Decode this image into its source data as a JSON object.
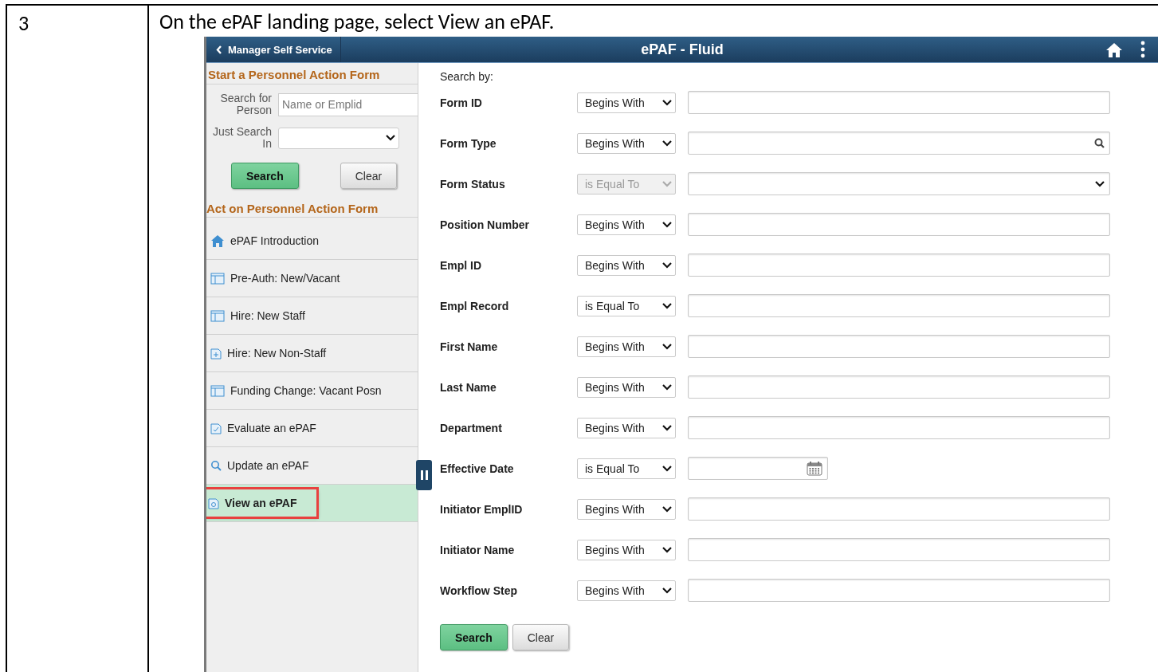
{
  "step": {
    "number": "3",
    "instruction": "On the ePAF landing page, select View an ePAF."
  },
  "app": {
    "header": {
      "back_label": "Manager Self Service",
      "title": "ePAF - Fluid"
    },
    "sidebar": {
      "start_section": {
        "title": "Start a Personnel Action Form",
        "person_label": "Search for Person",
        "person_placeholder": "Name or Emplid",
        "search_in_label": "Just Search In",
        "search_button": "Search",
        "clear_button": "Clear"
      },
      "act_section": {
        "title": "Act on Personnel Action Form"
      },
      "items": [
        {
          "label": "ePAF Introduction",
          "kind": "home",
          "selected": false,
          "annotated": false
        },
        {
          "label": "Pre-Auth: New/Vacant",
          "kind": "form",
          "selected": false,
          "annotated": false
        },
        {
          "label": "Hire: New Staff",
          "kind": "form",
          "selected": false,
          "annotated": false
        },
        {
          "label": "Hire: New Non-Staff",
          "kind": "add",
          "selected": false,
          "annotated": false
        },
        {
          "label": "Funding Change: Vacant Posn",
          "kind": "form",
          "selected": false,
          "annotated": false
        },
        {
          "label": "Evaluate an ePAF",
          "kind": "check",
          "selected": false,
          "annotated": false
        },
        {
          "label": "Update an ePAF",
          "kind": "search",
          "selected": false,
          "annotated": false
        },
        {
          "label": "View an ePAF",
          "kind": "view",
          "selected": true,
          "annotated": true
        }
      ]
    },
    "main": {
      "search_by": "Search by:",
      "fields": [
        {
          "label": "Form ID",
          "operator": "Begins With",
          "disabled": false,
          "kind": "text"
        },
        {
          "label": "Form Type",
          "operator": "Begins With",
          "disabled": false,
          "kind": "lookup"
        },
        {
          "label": "Form Status",
          "operator": "is Equal To",
          "disabled": true,
          "kind": "dropdown"
        },
        {
          "label": "Position Number",
          "operator": "Begins With",
          "disabled": false,
          "kind": "text"
        },
        {
          "label": "Empl ID",
          "operator": "Begins With",
          "disabled": false,
          "kind": "text"
        },
        {
          "label": "Empl Record",
          "operator": "is Equal To",
          "disabled": false,
          "kind": "text"
        },
        {
          "label": "First Name",
          "operator": "Begins With",
          "disabled": false,
          "kind": "text"
        },
        {
          "label": "Last Name",
          "operator": "Begins With",
          "disabled": false,
          "kind": "text"
        },
        {
          "label": "Department",
          "operator": "Begins With",
          "disabled": false,
          "kind": "text"
        },
        {
          "label": "Effective Date",
          "operator": "is Equal To",
          "disabled": false,
          "kind": "date"
        },
        {
          "label": "Initiator EmplID",
          "operator": "Begins With",
          "disabled": false,
          "kind": "text"
        },
        {
          "label": "Initiator Name",
          "operator": "Begins With",
          "disabled": false,
          "kind": "text"
        },
        {
          "label": "Workflow Step",
          "operator": "Begins With",
          "disabled": false,
          "kind": "text"
        }
      ],
      "search_button": "Search",
      "clear_button": "Clear"
    }
  }
}
